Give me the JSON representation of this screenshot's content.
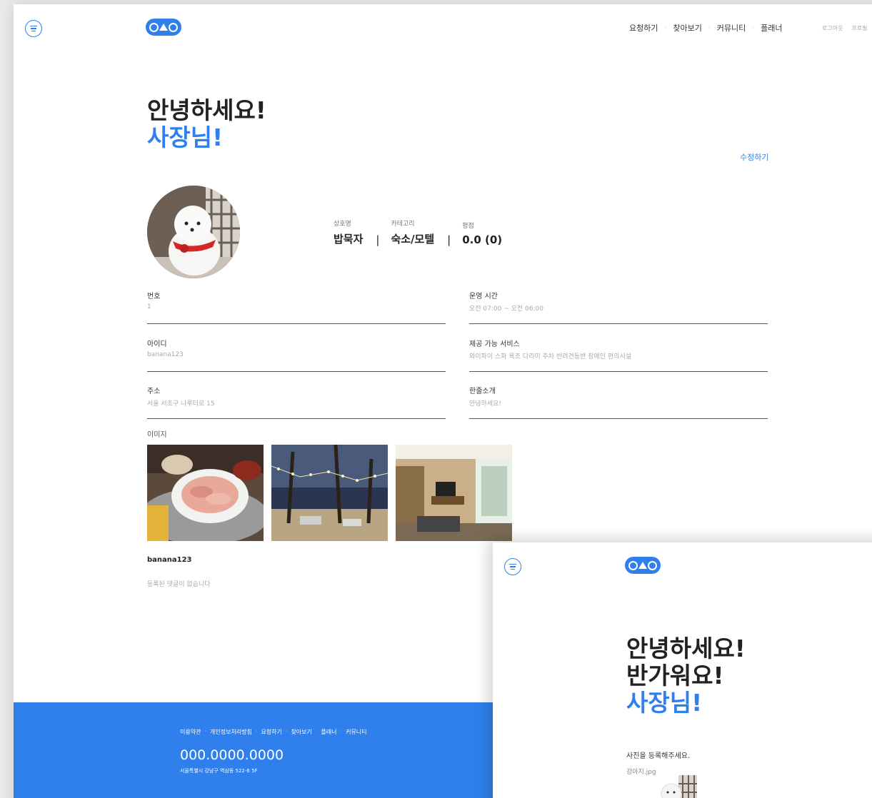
{
  "main": {
    "nav": [
      "요청하기",
      "찾아보기",
      "커뮤니티",
      "플래너"
    ],
    "nav_separator": "·",
    "auth": [
      "로그아웃",
      "프로필"
    ],
    "greeting": "안녕하세요!",
    "greeting_name": "사장님!",
    "edit_label": "수정하기",
    "summary": [
      {
        "label": "상호명",
        "value": "밥묵자"
      },
      {
        "label": "카테고리",
        "value": "숙소/모텔"
      },
      {
        "label": "평점",
        "value": "0.0 (0)"
      }
    ],
    "summary_separator": "|",
    "fields": [
      {
        "label": "번호",
        "value": "1"
      },
      {
        "label": "운영 시간",
        "value": "오전  07:00 ~ 오전  06:00"
      },
      {
        "label": "아이디",
        "value": "banana123"
      },
      {
        "label": "제공 가능 서비스",
        "value": "와이파이 스파 욕조 다리미 주차 반려견동반 장애인 편의시설"
      },
      {
        "label": "주소",
        "value": "서울 서초구 나루터로 15"
      },
      {
        "label": "한줄소개",
        "value": "안녕하세요!"
      }
    ],
    "images_label": "이미지",
    "comment_user": "banana123",
    "comment_empty": "등록된 댓글이 없습니다"
  },
  "footer": {
    "links": [
      "이용약관",
      "개인정보처리방침",
      "요청하기",
      "찾아보기",
      "플래너",
      "커뮤니티"
    ],
    "separator": "·",
    "phone": "000.0000.0000",
    "address": "서울특별시 강남구 역삼동 522-6 5F"
  },
  "front": {
    "greeting": "안녕하세요!",
    "greeting2": "반가워요!",
    "greeting_name": "사장님!",
    "upload_label": "사진을 등록해주세요.",
    "file_name": "강아지.jpg"
  },
  "colors": {
    "accent": "#2f80ed"
  }
}
